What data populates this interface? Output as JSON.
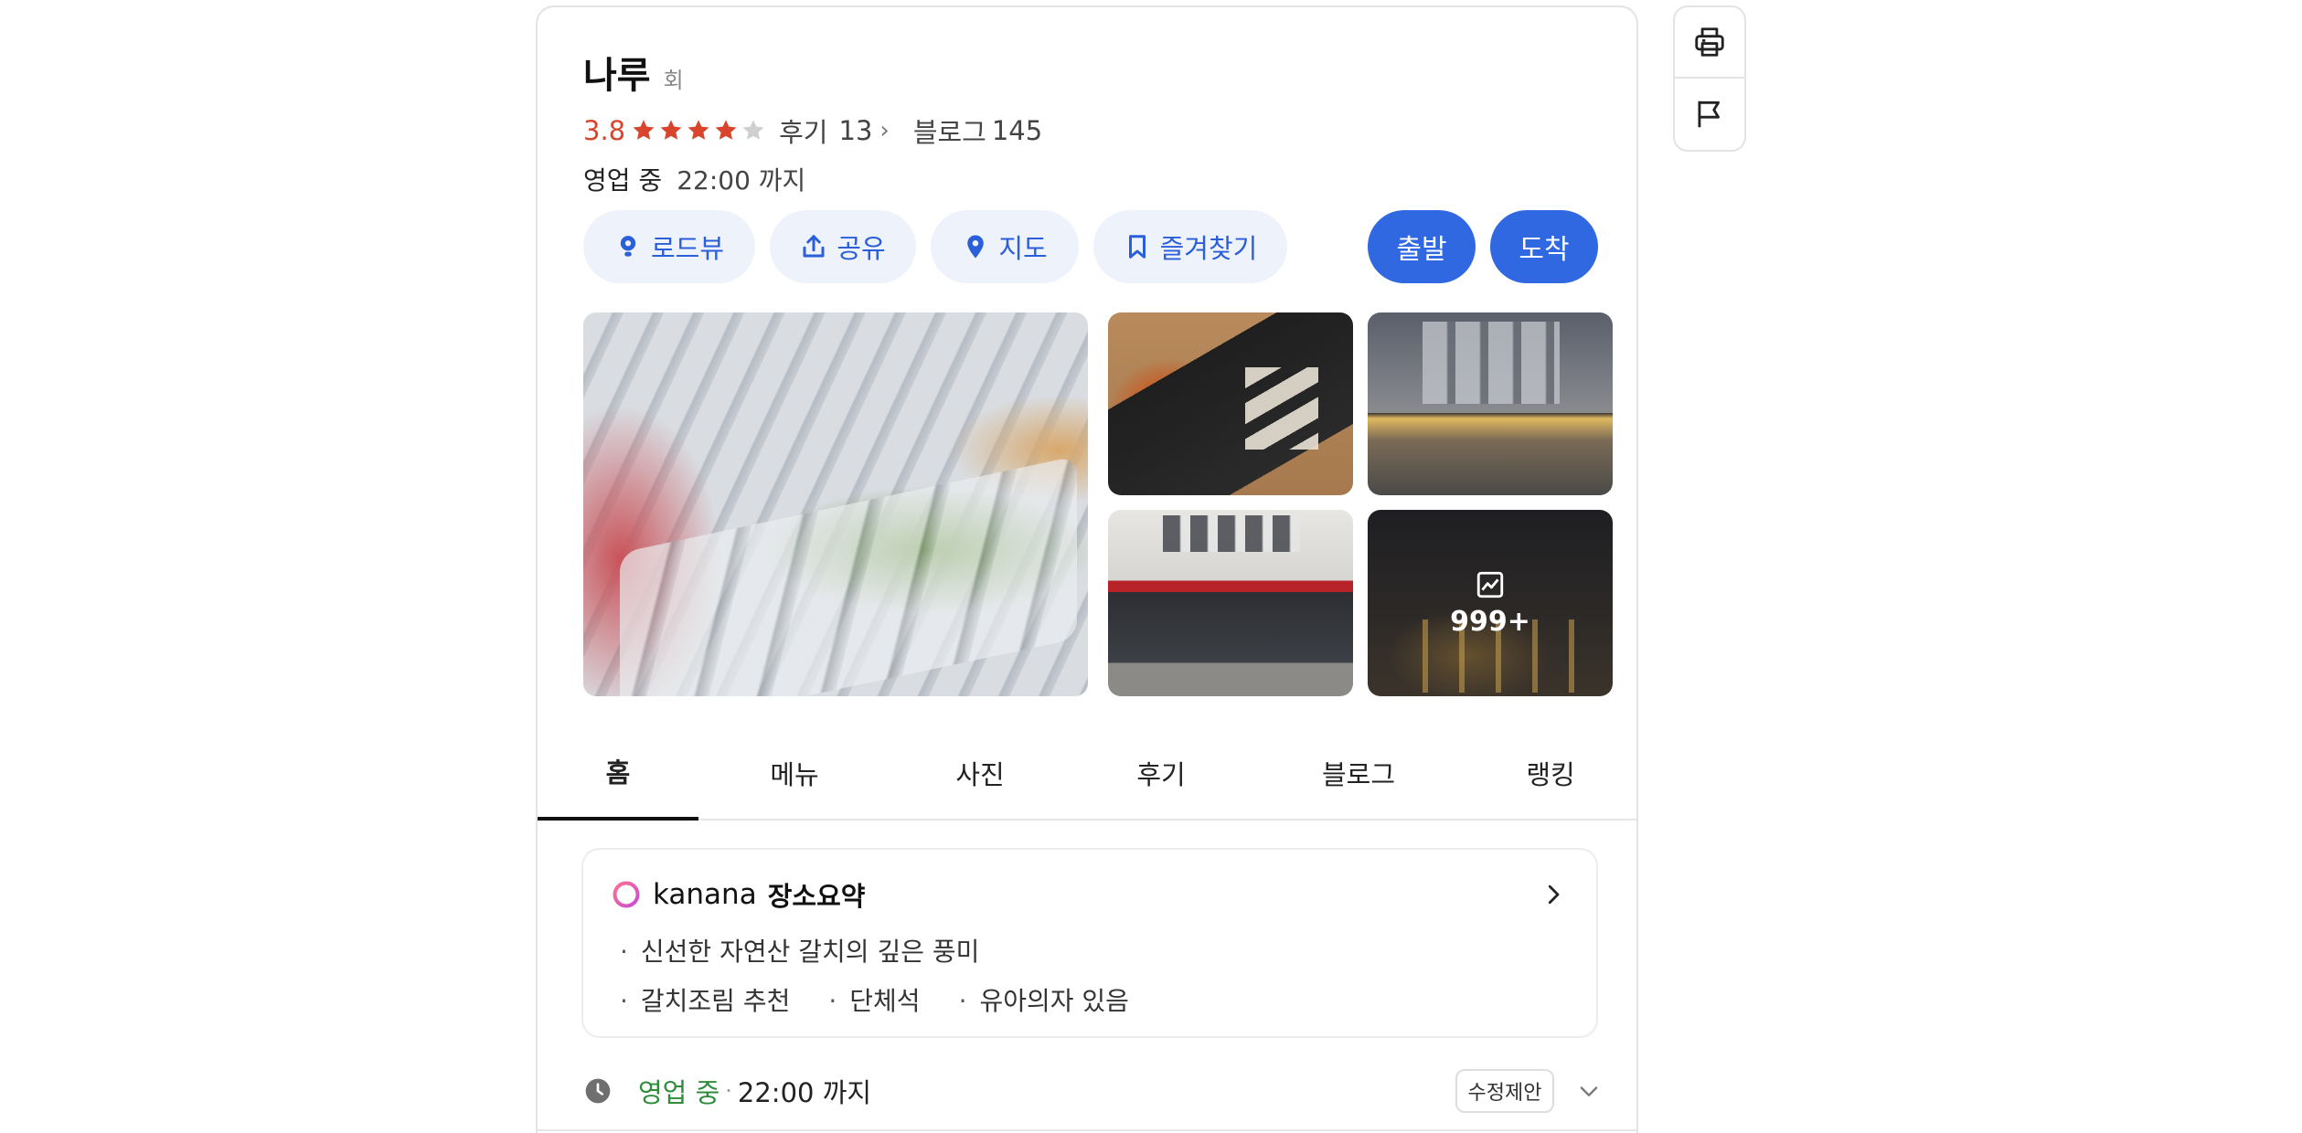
{
  "place": {
    "name": "나루",
    "category": "회",
    "rating": "3.8",
    "stars_filled": 4,
    "stars_total": 5,
    "review_label": "후기",
    "review_count": "13",
    "blog_label": "블로그",
    "blog_count": "145",
    "status": "영업 중",
    "hours": "22:00 까지"
  },
  "actions": {
    "roadview": "로드뷰",
    "share": "공유",
    "map": "지도",
    "favorite": "즐겨찾기",
    "start": "출발",
    "destination": "도착"
  },
  "photos": {
    "more_count": "999+"
  },
  "tabs": [
    "홈",
    "메뉴",
    "사진",
    "후기",
    "블로그",
    "랭킹"
  ],
  "summary": {
    "brand": "kanana",
    "title": "장소요약",
    "line1": "신선한 자연산 갈치의 깊은 풍미",
    "tags": [
      "갈치조림 추천",
      "단체석",
      "유아의자 있음"
    ]
  },
  "hours_row": {
    "status": "영업 중",
    "separator": "·",
    "time": "22:00 까지",
    "suggest_label": "수정제안"
  },
  "colors": {
    "accent_blue": "#2f68e0",
    "pill_bg": "#eef2fb",
    "rating_red": "#d9442c",
    "open_green": "#2f8c3b"
  },
  "icons": [
    "roadview-icon",
    "share-icon",
    "map-pin-icon",
    "bookmark-icon",
    "gallery-icon",
    "chevron-right-icon",
    "clock-icon",
    "chevron-down-icon",
    "print-icon",
    "flag-icon",
    "kanana-logo-icon"
  ]
}
